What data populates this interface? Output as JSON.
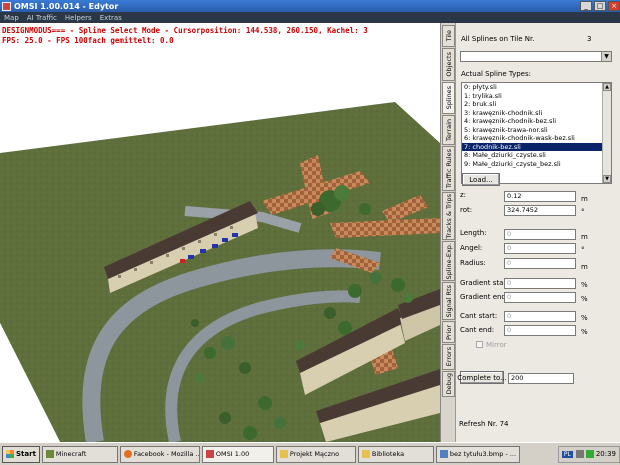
{
  "window": {
    "title": "OMSI 1.00.014 - Edytor",
    "buttons": [
      "_",
      "□",
      "×"
    ]
  },
  "menu": [
    "Map",
    "AI Traffic",
    "Helpers",
    "Extras"
  ],
  "viewport": {
    "status_line_1": "DESIGNMODUS=== - Spline Select Mode - Cursorposition: 144.538, 260.150, Kachel: 3",
    "status_line_2": "FPS: 25.0 - FPS 100fach gemittelt: 0.0"
  },
  "tabs": [
    "Tile",
    "Objects",
    "Splines",
    "Terrain",
    "Traffic Rules",
    "Tracks & Trips",
    "Spline-Exp.",
    "Signal Rts",
    "Prior",
    "Errors",
    "Debug"
  ],
  "panel": {
    "all_splines_label": "All Splines on Tile Nr.",
    "tile_number": "3",
    "actual_types_label": "Actual Spline Types:",
    "spline_types": [
      "0: płyty.sli",
      "1: trylika.sli",
      "2: bruk.sli",
      "3: krawęznik-chodnik.sli",
      "4: krawęznik-chodnik-bez.sli",
      "5: krawęznik-trawa-nor.sli",
      "6: krawęznik-chodnik-wask-bez.sli",
      "7: chodnik-bez.sli",
      "8: Małe_dziurki_czyste.sli",
      "9: Małe_dziurki_czyste_bez.sli"
    ],
    "selected_index": 7,
    "load_button": "Load...",
    "z_label": "z:",
    "z_value": "0.12",
    "z_unit": "m",
    "rot_label": "rot:",
    "rot_value": "324.7452",
    "rot_unit": "°",
    "length_label": "Length:",
    "length_value": "0",
    "length_unit": "m",
    "angle_label": "Angel:",
    "angle_value": "0",
    "angle_unit": "°",
    "radius_label": "Radius:",
    "radius_value": "0",
    "radius_unit": "m",
    "gradient_start_label": "Gradient start:",
    "gradient_start_value": "0",
    "gradient_start_unit": "%",
    "gradient_end_label": "Gradient end:",
    "gradient_end_value": "0",
    "gradient_end_unit": "%",
    "cant_start_label": "Cant start:",
    "cant_start_value": "0",
    "cant_start_unit": "%",
    "cant_end_label": "Cant end:",
    "cant_end_value": "0",
    "cant_end_unit": "%",
    "mirror_label": "Mirror",
    "complete_button": "Complete to...",
    "complete_value": "200",
    "refresh_label": "Refresh Nr. 74"
  },
  "taskbar": {
    "start": "Start",
    "tasks": [
      "Minecraft",
      "Facebook - Mozilla ...",
      "OMSI 1.00",
      "Projekt Mączno",
      "Biblioteka",
      "bez tytułu3.bmp - ..."
    ],
    "language": "PL",
    "clock": "20:39"
  },
  "colors": {
    "grass": "#5e6f3c",
    "road": "#8d969c",
    "building_roof": "#4a3a34",
    "building_wall": "#d8cfb0",
    "spline_orange": "#a0623a",
    "selection": "#0a246a"
  }
}
